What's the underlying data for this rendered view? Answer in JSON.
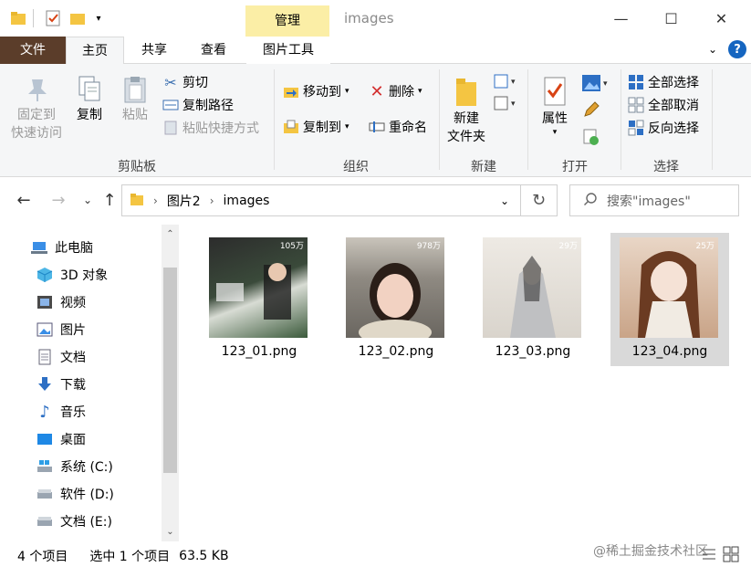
{
  "window": {
    "title": "images",
    "context_tab": "管理",
    "minimize": "—",
    "maximize": "☐",
    "close": "✕"
  },
  "tabs": {
    "file": "文件",
    "home": "主页",
    "share": "共享",
    "view": "查看",
    "picture_tools": "图片工具"
  },
  "ribbon": {
    "clipboard": {
      "label": "剪贴板",
      "pin": "固定到\n快速访问",
      "pin_l1": "固定到",
      "pin_l2": "快速访问",
      "copy": "复制",
      "paste": "粘贴",
      "cut": "剪切",
      "copy_path": "复制路径",
      "paste_shortcut": "粘贴快捷方式"
    },
    "organize": {
      "label": "组织",
      "move_to": "移动到",
      "copy_to": "复制到",
      "delete": "删除",
      "rename": "重命名"
    },
    "new": {
      "label": "新建",
      "new_folder_l1": "新建",
      "new_folder_l2": "文件夹"
    },
    "open": {
      "label": "打开",
      "properties": "属性"
    },
    "select": {
      "label": "选择",
      "select_all": "全部选择",
      "select_none": "全部取消",
      "invert": "反向选择"
    }
  },
  "address": {
    "crumbs": [
      "图片2",
      "images"
    ],
    "search_placeholder": "搜索\"images\""
  },
  "nav": [
    {
      "label": "此电脑",
      "icon": "computer-icon"
    },
    {
      "label": "3D 对象",
      "icon": "cube-icon"
    },
    {
      "label": "视频",
      "icon": "video-icon"
    },
    {
      "label": "图片",
      "icon": "picture-icon"
    },
    {
      "label": "文档",
      "icon": "document-icon"
    },
    {
      "label": "下载",
      "icon": "download-icon"
    },
    {
      "label": "音乐",
      "icon": "music-icon"
    },
    {
      "label": "桌面",
      "icon": "desktop-icon"
    },
    {
      "label": "系统 (C:)",
      "icon": "drive-c-icon"
    },
    {
      "label": "软件 (D:)",
      "icon": "drive-icon"
    },
    {
      "label": "文档 (E:)",
      "icon": "drive-icon"
    }
  ],
  "files": [
    {
      "name": "123_01.png",
      "badge": "105万",
      "selected": false
    },
    {
      "name": "123_02.png",
      "badge": "978万",
      "selected": false
    },
    {
      "name": "123_03.png",
      "badge": "29万",
      "selected": false
    },
    {
      "name": "123_04.png",
      "badge": "25万",
      "selected": true
    }
  ],
  "status": {
    "count": "4 个项目",
    "selected": "选中 1 个项目",
    "size": "63.5 KB"
  },
  "watermark": "@稀土掘金技术社区",
  "colors": {
    "file_tab": "#5b3d2a",
    "context_tab": "#fbeea6",
    "selected_item": "#d9d9d9",
    "help": "#1565c0"
  }
}
